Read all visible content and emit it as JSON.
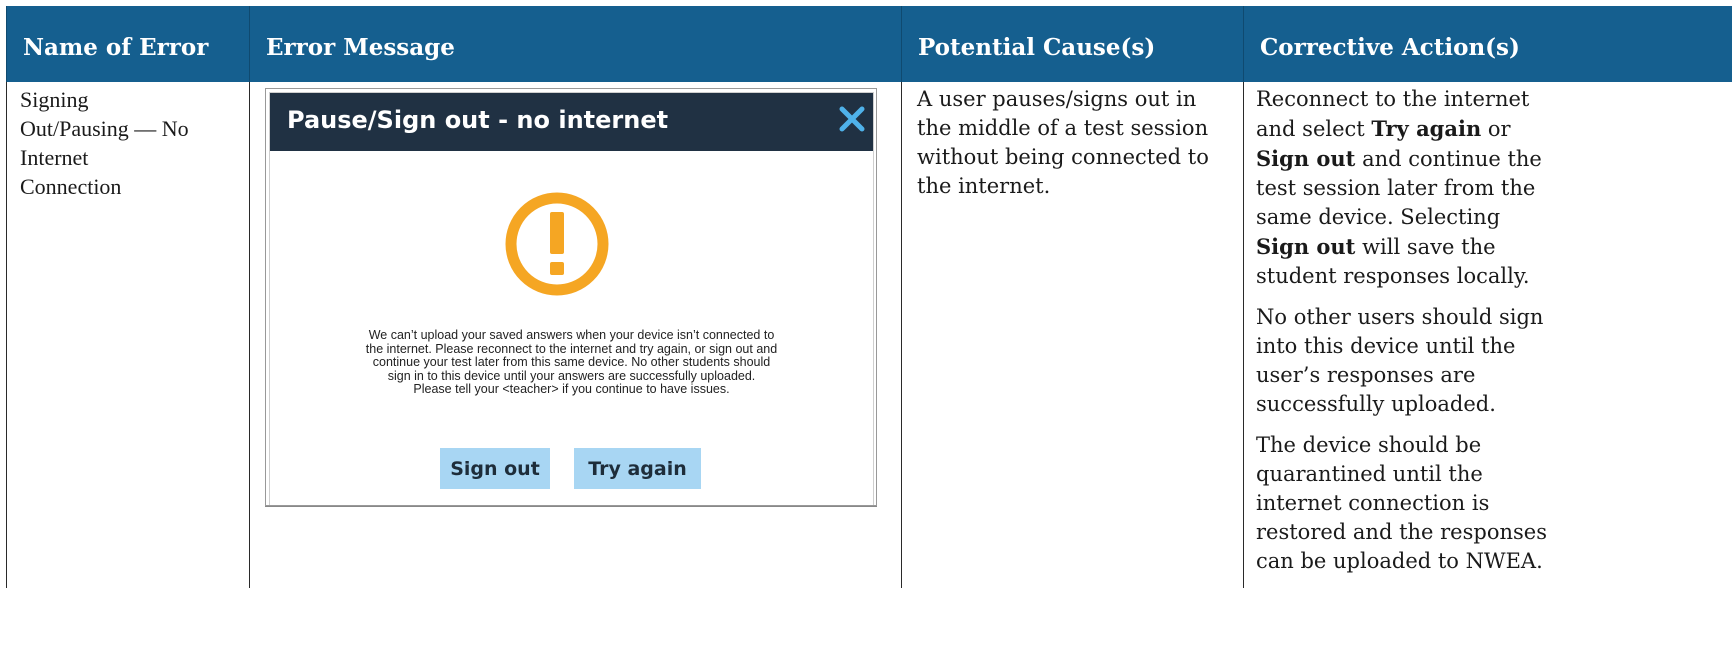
{
  "headers": [
    "Name of Error",
    "Error Message",
    "Potential Cause(s)",
    "Corrective Action(s)"
  ],
  "row": {
    "name_lines": [
      "Signing",
      "Out/Pausing — No",
      "Internet",
      "Connection"
    ],
    "potential_cause_lines": [
      "A user pauses/signs out in",
      "the middle of a test session",
      "without being connected to",
      "the internet."
    ],
    "corrective": {
      "p1_lines": [
        [
          "Reconnect to the internet",
          ""
        ],
        [
          "and select ",
          "Try again",
          " or"
        ],
        [
          "",
          "Sign out",
          " and continue the"
        ],
        [
          "test session later from the",
          ""
        ],
        [
          "same device. Selecting",
          ""
        ],
        [
          "",
          "Sign out",
          " will save the"
        ],
        [
          "student responses locally.",
          ""
        ]
      ],
      "p2_lines": [
        "No other users should sign",
        "into this device until the",
        "user’s responses are",
        "successfully uploaded."
      ],
      "p3_lines": [
        "The device should be",
        "quarantined until the",
        "internet connection is",
        "restored and the responses",
        "can be uploaded to NWEA."
      ]
    }
  },
  "dialog": {
    "title": "Pause/Sign out - no internet",
    "message_lines": [
      "We can’t upload your saved answers when your device isn’t connected to",
      "the internet. Please reconnect to the internet and try again, or sign out and",
      "continue your test later from this same device. No other students should",
      "sign in to this device until your answers are successfully uploaded.",
      "Please tell your <teacher> if you continue to have issues."
    ],
    "sign_out_label": "Sign out",
    "try_again_label": "Try again",
    "icons": {
      "close": "close-icon",
      "warning": "warning-icon"
    }
  },
  "colors": {
    "header_bg": "#155f8f",
    "dialog_bar": "#203143",
    "warning": "#f5a623",
    "button_bg": "#a8d6f3",
    "close_icon": "#4fb2ea"
  }
}
